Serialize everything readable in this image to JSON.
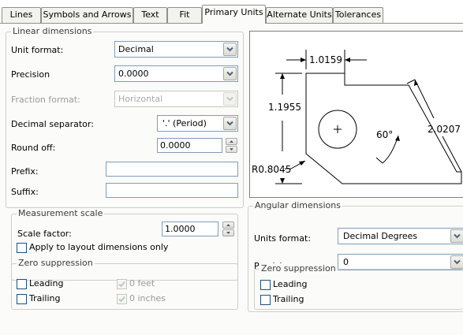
{
  "tabs": [
    {
      "label": "Lines",
      "active": false
    },
    {
      "label": "Symbols and Arrows",
      "active": false
    },
    {
      "label": "Text",
      "active": false
    },
    {
      "label": "Fit",
      "active": false
    },
    {
      "label": "Primary Units",
      "active": true
    },
    {
      "label": "Alternate Units",
      "active": false
    },
    {
      "label": "Tolerances",
      "active": false
    }
  ],
  "linear": {
    "title": "Linear dimensions",
    "unit_format_label": "Unit format:",
    "unit_format_value": "Decimal",
    "precision_label": "Precision",
    "precision_value": "0.0000",
    "fraction_label": "Fraction format:",
    "fraction_value": "Horizontal",
    "decimal_sep_label": "Decimal separator:",
    "decimal_sep_value": "'.' (Period)",
    "round_off_label": "Round off:",
    "round_off_value": "0.0000",
    "prefix_label": "Prefix:",
    "prefix_value": "",
    "suffix_label": "Suffix:",
    "suffix_value": ""
  },
  "measurement": {
    "title": "Measurement scale",
    "scale_label": "Scale factor:",
    "scale_value": "1.0000",
    "apply_label": "Apply to layout dimensions only",
    "apply_checked": false
  },
  "zero_linear": {
    "title": "Zero suppression",
    "leading_label": "Leading",
    "trailing_label": "Trailing",
    "feet_label": "0 feet",
    "inches_label": "0 inches",
    "leading_checked": false,
    "trailing_checked": false,
    "feet_checked": true,
    "inches_checked": true
  },
  "preview": {
    "dim_top": "1.0159",
    "dim_left": "1.1955",
    "dim_right": "2.0207",
    "angle": "60°",
    "radius": "R0.8045"
  },
  "angular": {
    "title": "Angular dimensions",
    "units_label": "Units format:",
    "units_value": "Decimal Degrees",
    "precision_label": "Precision:",
    "precision_value": "0"
  },
  "zero_angular": {
    "title": "Zero suppression",
    "leading_label": "Leading",
    "trailing_label": "Trailing",
    "leading_checked": false,
    "trailing_checked": false
  },
  "colors": {
    "panel": "#fbfbf9",
    "field_border": "#7f9db9",
    "check_mark": "#b8c8d8"
  }
}
